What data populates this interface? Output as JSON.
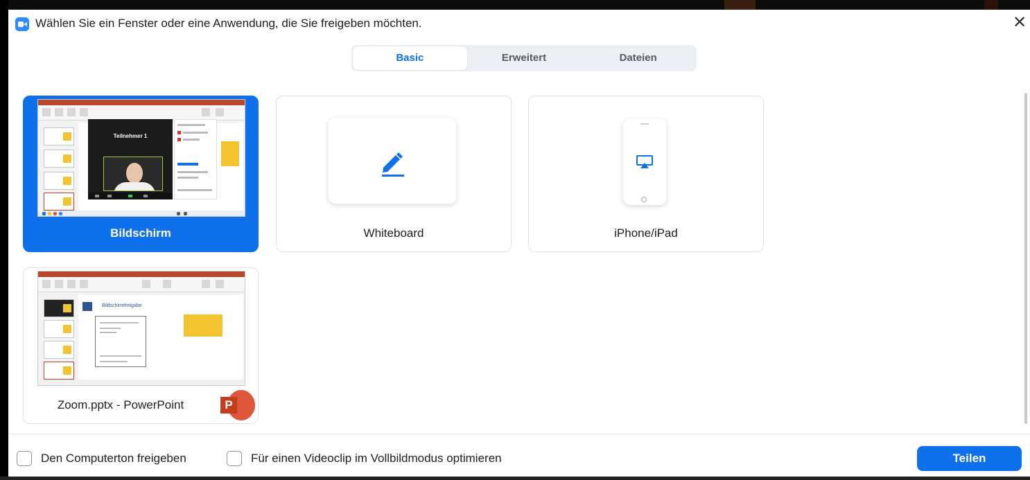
{
  "dialog": {
    "title": "Wählen Sie ein Fenster oder eine Anwendung, die Sie freigeben möchten.",
    "close_icon": "close-icon",
    "close_glyph": "✕"
  },
  "tabs": [
    {
      "label": "Basic",
      "active": true
    },
    {
      "label": "Erweitert",
      "active": false
    },
    {
      "label": "Dateien",
      "active": false
    }
  ],
  "cards": [
    {
      "label": "Bildschirm",
      "selected": true,
      "thumb": {
        "participant_name": "Teilnehmer 1"
      }
    },
    {
      "label": "Whiteboard",
      "selected": false,
      "icon": "pen-icon"
    },
    {
      "label": "iPhone/iPad",
      "selected": false,
      "icon": "airplay-icon"
    },
    {
      "label": "Zoom.pptx - PowerPoint",
      "selected": false,
      "app_icon": "powerpoint-icon",
      "app_icon_letter": "P",
      "thumb": {
        "slide_title": "Bildschirmfreigabe"
      }
    }
  ],
  "footer": {
    "share_audio_label": "Den Computerton freigeben",
    "share_audio_checked": false,
    "optimize_video_label": "Für einen Videoclip im Vollbildmodus optimieren",
    "optimize_video_checked": false,
    "share_button_label": "Teilen"
  },
  "colors": {
    "accent": "#0e71eb",
    "tab_bg": "#eceff3",
    "card_border": "#dfe1e5",
    "powerpoint": "#c43e1c"
  }
}
